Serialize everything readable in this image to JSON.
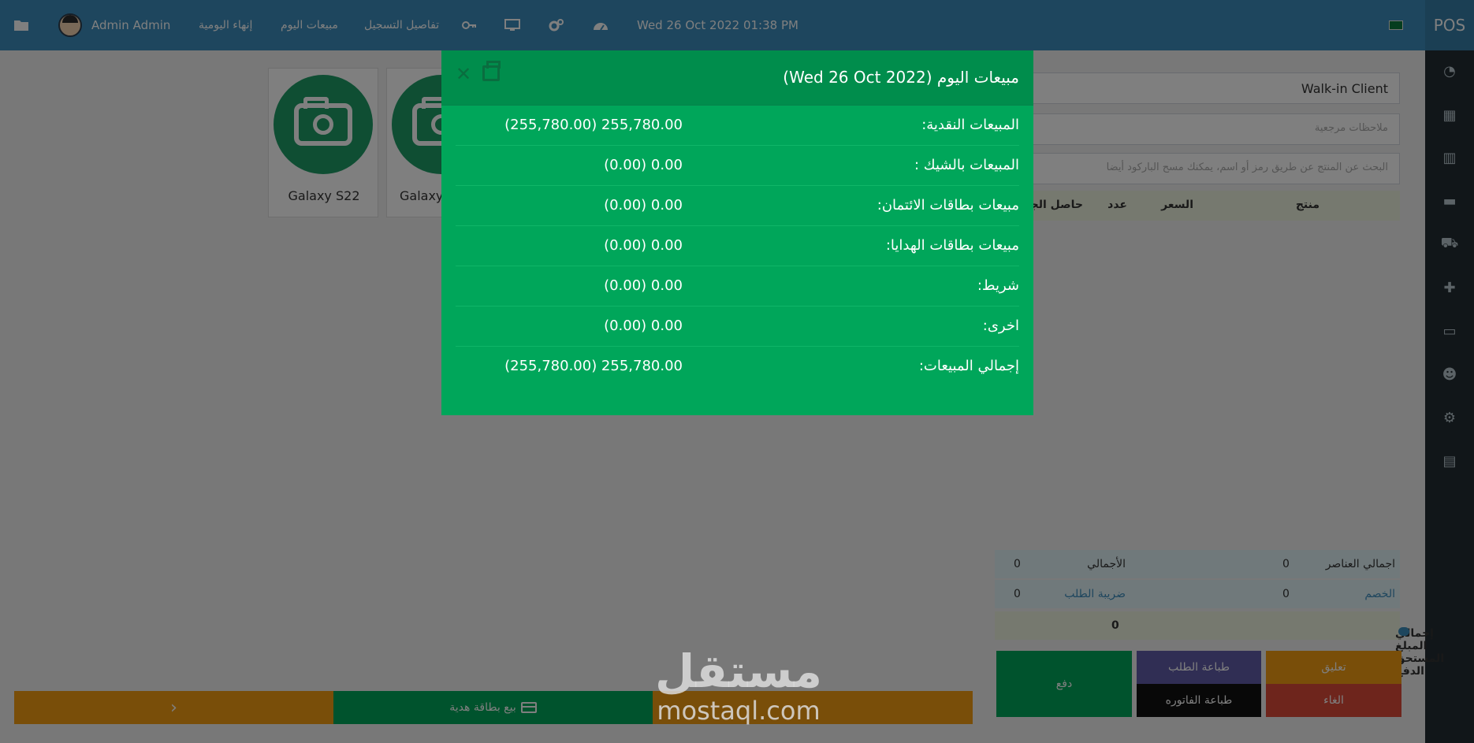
{
  "topbar": {
    "user": "Admin Admin",
    "end_of_day": "إنهاء اليومية",
    "today_sales": "مبيعات اليوم",
    "register_details": "تفاصيل التسجيل",
    "datetime": "Wed 26 Oct 2022 01:38 PM",
    "brand": "POS"
  },
  "products": [
    {
      "name": "Galaxy S22"
    },
    {
      "name": "Galaxy"
    }
  ],
  "right_panel": {
    "client": "Walk-in Client",
    "notes_placeholder": "ملاحظات مرجعية",
    "search_placeholder": "البحث عن المنتج عن طريق رمز أو اسم، يمكنك مسح الباركود أيضا",
    "columns": [
      "منتج",
      "السعر",
      "عدد",
      "حاصل الجمع"
    ]
  },
  "totals": {
    "items_label": "اجمالي العناصر",
    "items_value": "0",
    "total_label": "الأجمالي",
    "total_value": "0",
    "discount_label": "الخصم",
    "discount_value": "0",
    "tax_label": "ضريبة الطلب",
    "tax_value": "0",
    "due_label": "إجمالي المبلغ المستحق الدفع",
    "due_value": "0"
  },
  "actions": {
    "suspend": "تعليق",
    "print_order": "طباعة الطلب",
    "pay": "دفع",
    "cancel": "الغاء",
    "print_invoice": "طباعة الفاتوره"
  },
  "bottom": {
    "gift_card": "بيع بطاقة هدية",
    "next": "›"
  },
  "modal": {
    "title": "مبيعات اليوم (Wed 26 Oct 2022)",
    "rows": [
      {
        "label": "المبيعات النقدية:",
        "value": "(255,780.00) 255,780.00"
      },
      {
        "label": "المبيعات بالشيك :",
        "value": "(0.00) 0.00"
      },
      {
        "label": "مبيعات بطاقات الائتمان:",
        "value": "(0.00) 0.00"
      },
      {
        "label": "مبيعات بطاقات الهدايا:",
        "value": "(0.00) 0.00"
      },
      {
        "label": "شريط:",
        "value": "(0.00) 0.00"
      },
      {
        "label": "اخرى:",
        "value": "(0.00) 0.00"
      },
      {
        "label": "إجمالي المبيعات:",
        "value": "(255,780.00) 255,780.00"
      }
    ]
  },
  "watermark": {
    "arabic": "مستقل",
    "latin": "mostaql.com"
  },
  "colors": {
    "topbar": "#3c8dbc",
    "sidebar": "#222d32",
    "modal": "#00a65a",
    "modal_header": "#008d4c",
    "suspend": "#f39c12",
    "print_order": "#605ca8",
    "cancel": "#dd4b39"
  }
}
